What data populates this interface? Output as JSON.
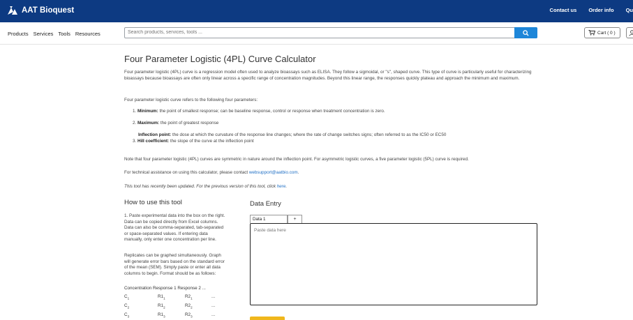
{
  "topbar": {
    "brand": "AAT Bioquest",
    "links": [
      "Contact us",
      "Order info",
      "Qu"
    ]
  },
  "nav": {
    "links": [
      "Products",
      "Services",
      "Tools",
      "Resources"
    ],
    "search_placeholder": "Search products, services, tools ...",
    "cart_label": "Cart ( 0 )"
  },
  "page": {
    "title": "Four Parameter Logistic (4PL) Curve Calculator",
    "intro": "Four parameter logistic (4PL) curve is a regression model often used to analyze bioassays such as ELISA. They follow a sigmoidal, or \"s\", shaped curve. This type of curve is particularly useful for characterizing bioassays because bioassays are often only linear across a specific range of concentration magnitudes. Beyond this linear range, the responses quickly plateau and approach the minimum and maximum.",
    "params_heading": "Four parameter logistic curve refers to the following four parameters:",
    "params": [
      {
        "num": "1.",
        "term": "Minimum:",
        "desc": " the point of smallest response; can be baseline response, control or response when treatment concentration is zero."
      },
      {
        "num": "2.",
        "term": "Maximum:",
        "desc": " the point of greatest response"
      },
      {
        "num": "",
        "term": "Inflection point:",
        "desc": " the dose at which the curvature of the response line changes; where the rate of change switches signs; often referred to as the IC50 or EC50"
      },
      {
        "num": "3.",
        "term": "Hill coefficient:",
        "desc": " the slope of the curve at the inflection point"
      }
    ],
    "note": "Note that four parameter logistic (4PL) curves are symmetric in nature around the inflection point. For asymmetric logistic curves, a five parameter logistic (5PL) curve is required.",
    "support_prefix": "For technical assistance on using this calculator, please contact ",
    "support_email": "websupport@aatbio.com",
    "support_suffix": ".",
    "updated_prefix": "This tool has recently been updated. For the previous version of this tool, click ",
    "updated_link": "here",
    "updated_suffix": "."
  },
  "howto": {
    "heading": "How to use this tool",
    "para1": [
      "1. Paste experimental data into the box on the right.",
      "Data can be copied directly from Excel columns.",
      "Data can also be comma-separated, tab-separated",
      "or space-separated values. If entering data",
      "manually, only enter one concentration per line."
    ],
    "para2": [
      "Replicates can be graphed simultaneously. Graph",
      "will generate error bars based on the standard error",
      "of the mean (SEM). Simply paste or enter all data",
      "columns to begin. Format should be as follows:"
    ],
    "table_header": [
      "Concentration",
      "Response 1",
      "Response 2",
      "..."
    ],
    "table_rows": [
      [
        "C",
        "1",
        "R1",
        "1",
        "R2",
        "1",
        "..."
      ],
      [
        "C",
        "2",
        "R1",
        "2",
        "R2",
        "2",
        "..."
      ],
      [
        "C",
        "3",
        "R1",
        "3",
        "R2",
        "3",
        "..."
      ]
    ]
  },
  "data_entry": {
    "heading": "Data Entry",
    "tab_label": "Data 1",
    "add_label": "+",
    "placeholder": "Paste data here"
  }
}
